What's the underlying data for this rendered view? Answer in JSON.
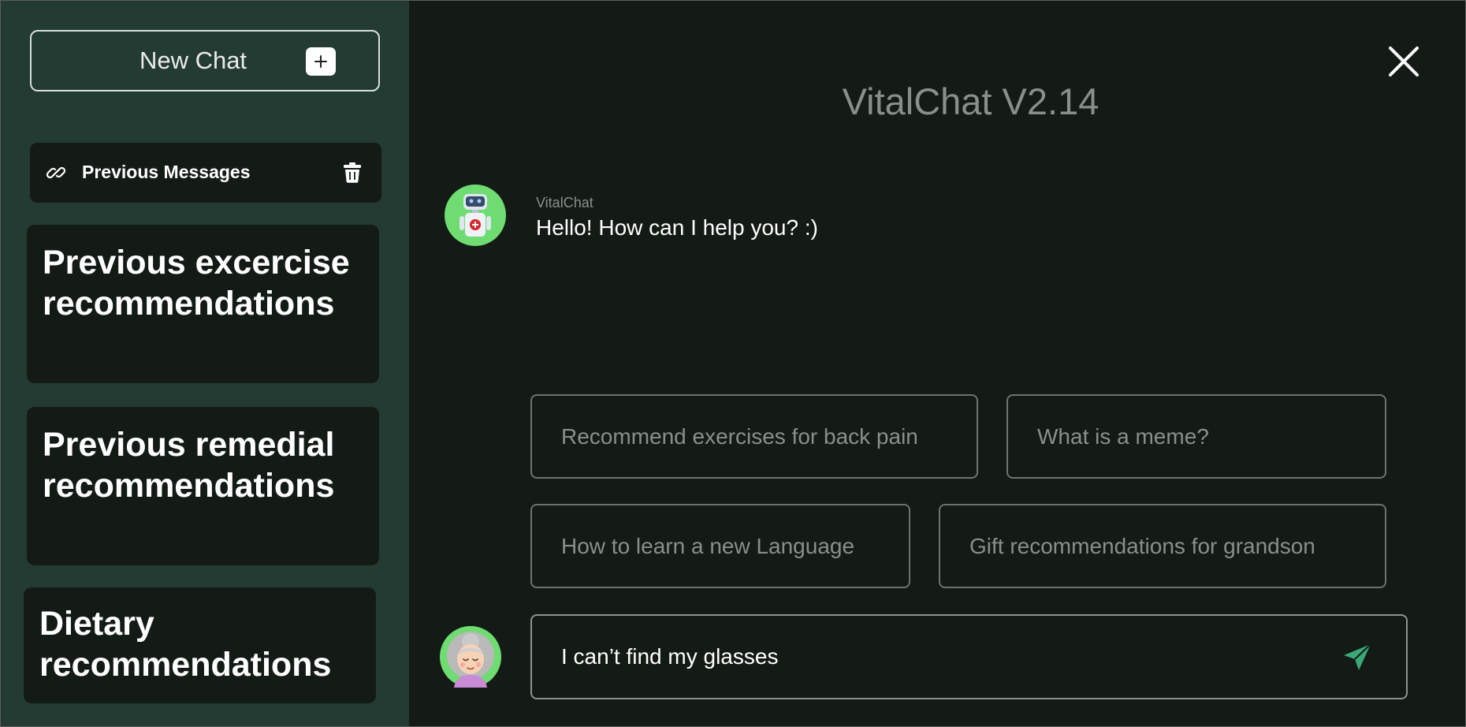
{
  "sidebar": {
    "new_chat_label": "New Chat",
    "previous_messages_label": "Previous Messages",
    "history": [
      {
        "title": "Previous excercise recommendations"
      },
      {
        "title": "Previous remedial recommendations"
      },
      {
        "title": "Dietary recommendations"
      }
    ]
  },
  "main": {
    "title": "VitalChat V2.14",
    "bot_name": "VitalChat",
    "bot_message": "Hello! How can I help you? :)",
    "suggestions": [
      "Recommend exercises for back pain",
      "What is a meme?",
      "How to learn a new Language",
      "Gift recommendations for grandson"
    ],
    "input_value": "I can’t find my glasses"
  },
  "icons": {
    "new_chat": "plus-icon",
    "previous_messages": "link-icon",
    "delete": "trash-icon",
    "close": "close-icon",
    "bot": "robot-avatar-icon",
    "user": "user-avatar-icon",
    "send": "send-icon"
  },
  "colors": {
    "sidebar_bg": "#243b33",
    "main_bg": "#141b16",
    "send_accent": "#3aa878",
    "avatar_green": "#6fdc71"
  }
}
